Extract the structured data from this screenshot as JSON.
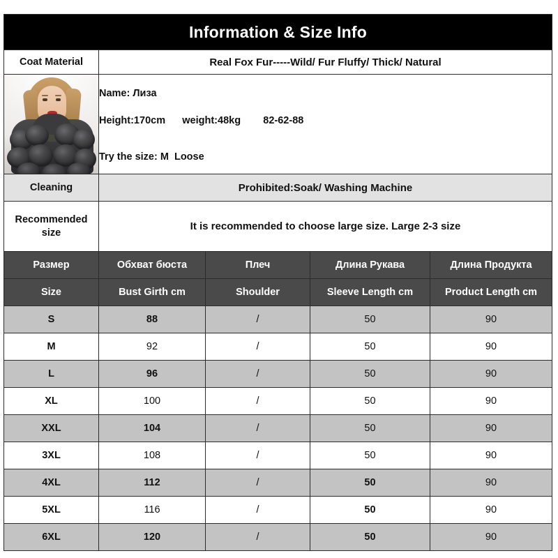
{
  "title": "Information & Size Info",
  "rows": {
    "material_label": "Coat Material",
    "material_value": "Real  Fox  Fur-----Wild/ Fur Fluffy/ Thick/ Natural",
    "model_name": "Name: Лиза",
    "model_measures": "Height:170cm      weight:48kg        82-62-88",
    "model_try": "Try the size: M  Loose",
    "cleaning_label": "Cleaning",
    "cleaning_value": "Prohibited:Soak/ Washing Machine",
    "recommended_label": "Recommended size",
    "recommended_value": "It is recommended to choose large size. Large 2-3 size"
  },
  "photo": {
    "alt": "model-wearing-dark-gray-fox-fur-coat"
  },
  "size_table": {
    "headers_ru": [
      "Размер",
      "Обхват бюста",
      "Плеч",
      "Длина Рукава",
      "Длина Продукта"
    ],
    "headers_en": [
      "Size",
      "Bust Girth cm",
      "Shoulder",
      "Sleeve Length cm",
      "Product Length cm"
    ],
    "rows": [
      {
        "size": "S",
        "bust": "88",
        "shoulder": "/",
        "sleeve": "50",
        "length": "90",
        "band": "gray"
      },
      {
        "size": "M",
        "bust": "92",
        "shoulder": "/",
        "sleeve": "50",
        "length": "90",
        "band": "white"
      },
      {
        "size": "L",
        "bust": "96",
        "shoulder": "/",
        "sleeve": "50",
        "length": "90",
        "band": "gray"
      },
      {
        "size": "XL",
        "bust": "100",
        "shoulder": "/",
        "sleeve": "50",
        "length": "90",
        "band": "white"
      },
      {
        "size": "XXL",
        "bust": "104",
        "shoulder": "/",
        "sleeve": "50",
        "length": "90",
        "band": "gray"
      },
      {
        "size": "3XL",
        "bust": "108",
        "shoulder": "/",
        "sleeve": "50",
        "length": "90",
        "band": "white"
      },
      {
        "size": "4XL",
        "bust": "112",
        "shoulder": "/",
        "sleeve": "50",
        "length": "90",
        "band": "gray"
      },
      {
        "size": "5XL",
        "bust": "116",
        "shoulder": "/",
        "sleeve": "50",
        "length": "90",
        "band": "white"
      },
      {
        "size": "6XL",
        "bust": "120",
        "shoulder": "/",
        "sleeve": "50",
        "length": "90",
        "band": "gray"
      }
    ]
  },
  "colors": {
    "title_bg": "#000000",
    "header_bg": "#4a4a4a",
    "band_gray": "#c3c3c3",
    "band_white": "#ffffff",
    "light_gray": "#e2e2e2",
    "border": "#2b2b2b"
  }
}
